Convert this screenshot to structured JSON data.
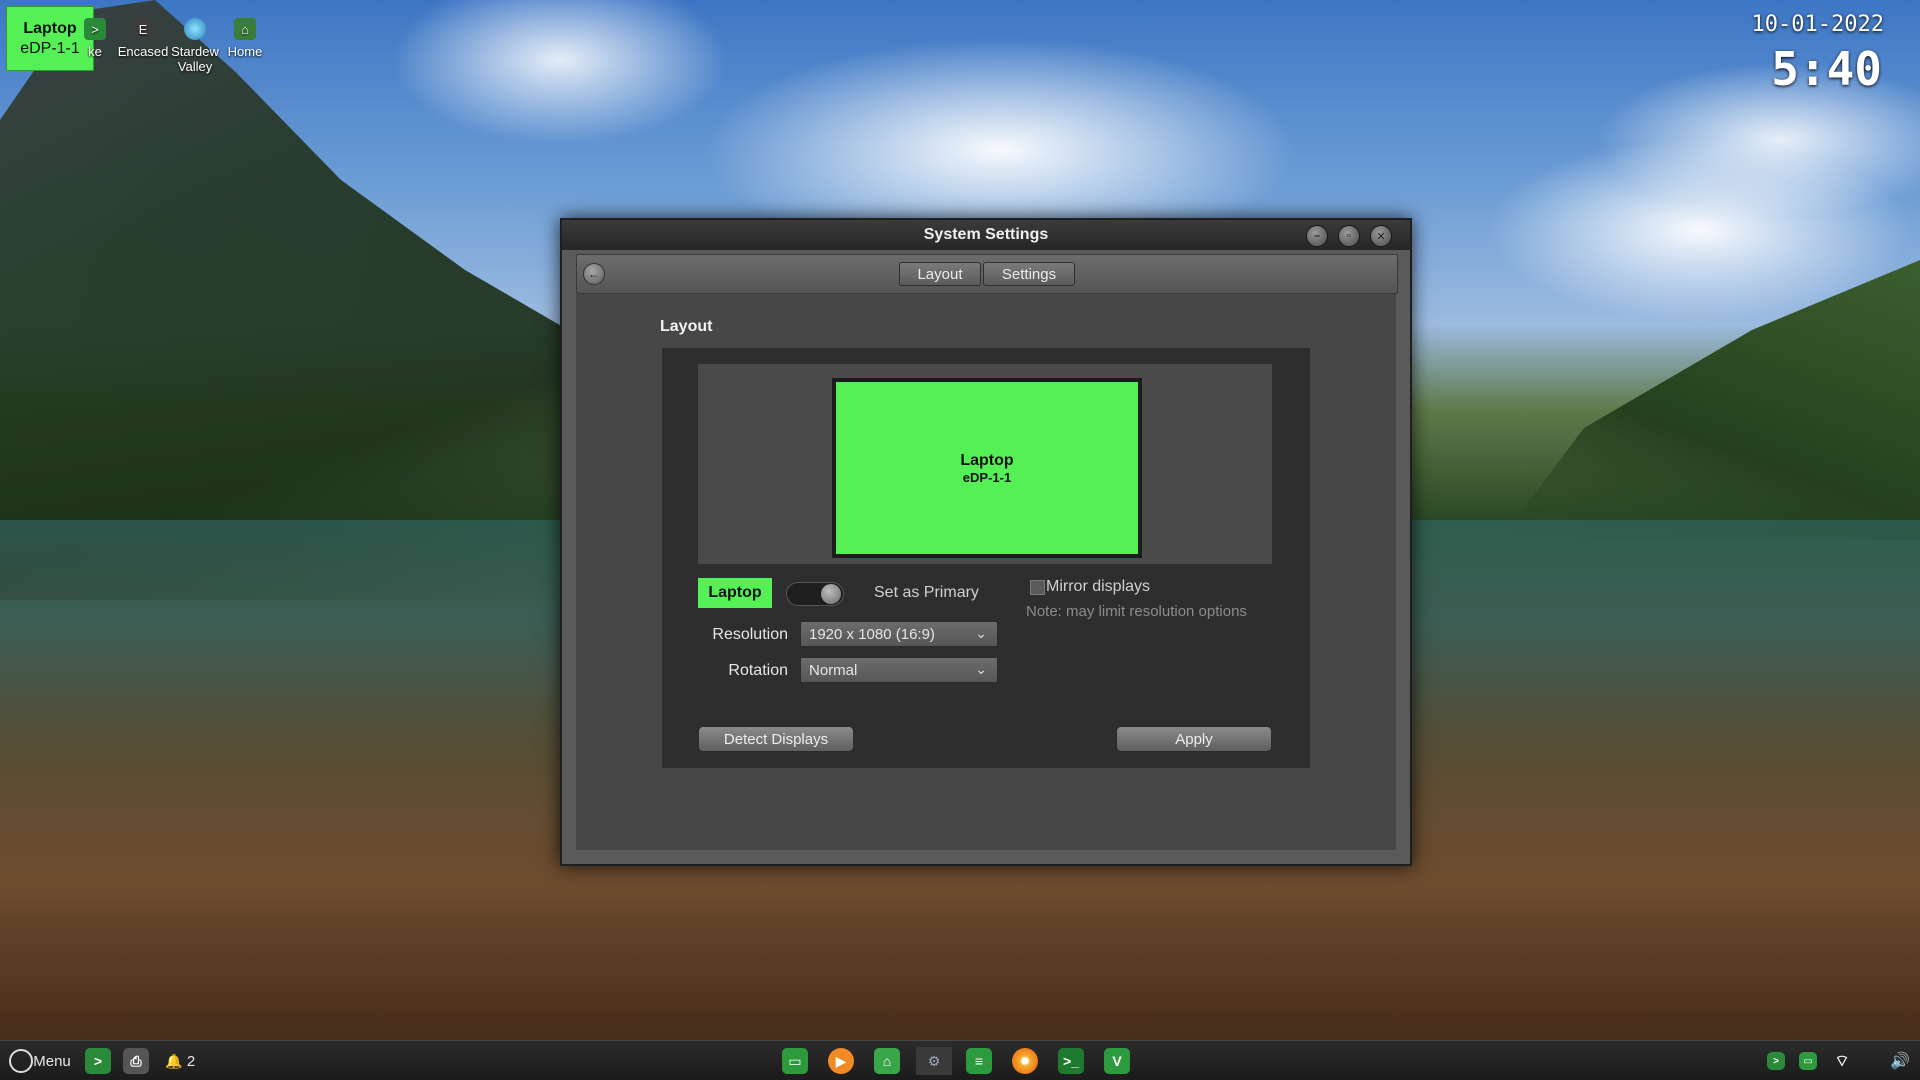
{
  "osd": {
    "name": "Laptop",
    "connector": "eDP-1-1"
  },
  "desktop_icons": [
    {
      "label": "ke",
      "icon": "terminal-icon"
    },
    {
      "label": "Encased",
      "icon": "encased-app-icon"
    },
    {
      "label": "Stardew Valley",
      "icon": "stardew-valley-icon"
    },
    {
      "label": "Home",
      "icon": "home-folder-icon"
    }
  ],
  "clock": {
    "date": "10-01-2022",
    "time": "5:40"
  },
  "window": {
    "title": "System Settings",
    "tabs": [
      "Layout",
      "Settings"
    ],
    "section_title": "Layout",
    "monitor": {
      "name": "Laptop",
      "connector": "eDP-1-1"
    },
    "display_label": "Laptop",
    "set_primary_label": "Set as Primary",
    "mirror_label": "Mirror displays",
    "mirror_note": "Note: may limit resolution options",
    "resolution_label": "Resolution",
    "resolution_value": "1920 x 1080 (16:9)",
    "rotation_label": "Rotation",
    "rotation_value": "Normal",
    "detect_button": "Detect Displays",
    "apply_button": "Apply"
  },
  "taskbar": {
    "menu_label": "Menu",
    "notification_count": "2"
  },
  "colors": {
    "display_green": "#55f055",
    "window_bg": "#474747",
    "panel_bg": "#2e2e2e"
  }
}
